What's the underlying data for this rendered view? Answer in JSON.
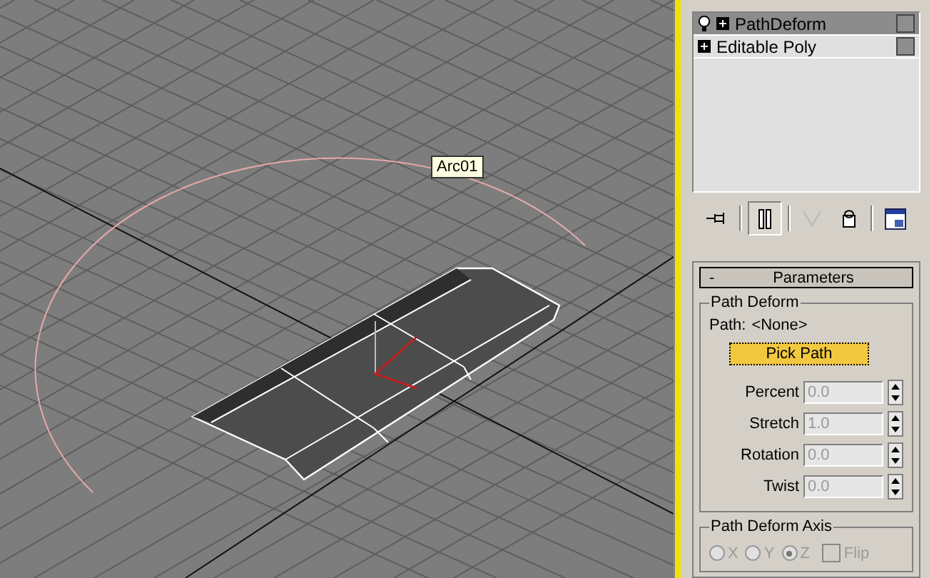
{
  "viewport": {
    "object_label": "Arc01"
  },
  "modifier_stack": {
    "items": [
      {
        "label": "PathDeform",
        "selected": true,
        "light_bulb": true
      },
      {
        "label": "Editable Poly",
        "selected": false,
        "light_bulb": false
      }
    ]
  },
  "stack_toolbar": [
    {
      "kind": "pin",
      "pressed": false,
      "disabled": false
    },
    {
      "kind": "end-result",
      "pressed": true,
      "disabled": false
    },
    {
      "kind": "unique",
      "pressed": false,
      "disabled": true
    },
    {
      "kind": "remove",
      "pressed": false,
      "disabled": false
    },
    {
      "kind": "configure",
      "pressed": false,
      "disabled": false
    }
  ],
  "rollout": {
    "toggle": "-",
    "title": "Parameters",
    "path_deform": {
      "title": "Path Deform",
      "path_label": "Path:",
      "path_value": "<None>",
      "pick_button": "Pick Path",
      "spinners": [
        {
          "label": "Percent",
          "value": "0.0",
          "disabled": true
        },
        {
          "label": "Stretch",
          "value": "1.0",
          "disabled": true
        },
        {
          "label": "Rotation",
          "value": "0.0",
          "disabled": true
        },
        {
          "label": "Twist",
          "value": "0.0",
          "disabled": true
        }
      ]
    },
    "axis": {
      "title": "Path Deform Axis",
      "disabled": true,
      "options": [
        {
          "label": "X",
          "selected": false
        },
        {
          "label": "Y",
          "selected": false
        },
        {
          "label": "Z",
          "selected": true
        }
      ],
      "flip": {
        "label": "Flip",
        "checked": false
      }
    }
  }
}
